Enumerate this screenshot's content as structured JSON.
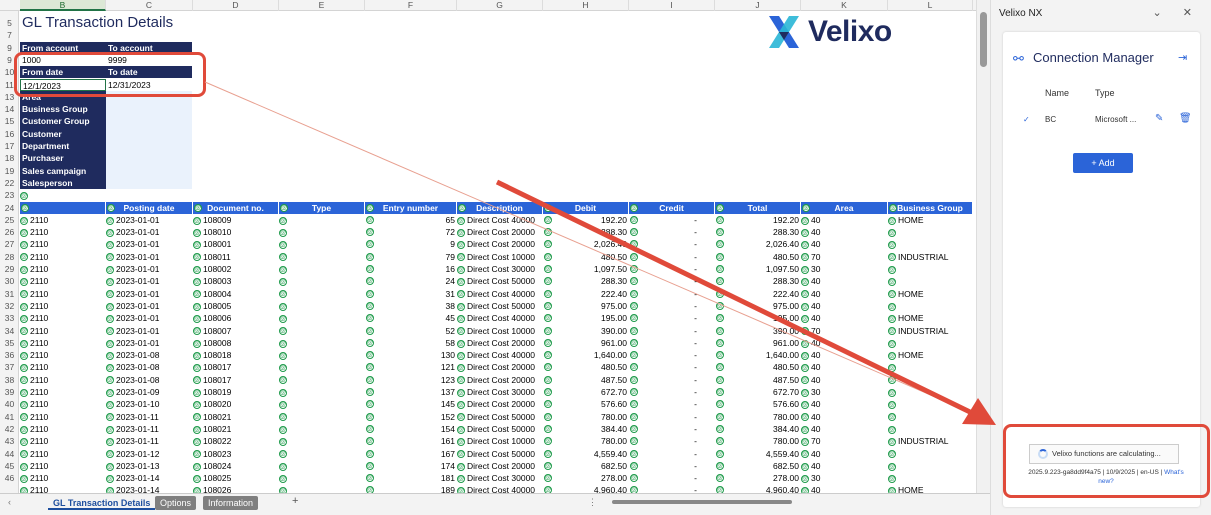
{
  "sheet": {
    "title": "GL Transaction Details",
    "logo_text": "Velixo",
    "column_letters": [
      "B",
      "C",
      "D",
      "E",
      "F",
      "G",
      "H",
      "I",
      "J",
      "K",
      "L"
    ],
    "row_numbers": [
      "5",
      "7",
      "9",
      "9",
      "10",
      "11",
      "13",
      "14",
      "15",
      "16",
      "17",
      "18",
      "19",
      "22",
      "23",
      "24",
      "25",
      "26",
      "27",
      "28",
      "29",
      "30",
      "31",
      "32",
      "33",
      "34",
      "35",
      "36",
      "37",
      "38",
      "39",
      "40",
      "41",
      "42",
      "43",
      "44",
      "45",
      "46"
    ],
    "params": {
      "from_account_label": "From account",
      "to_account_label": "To account",
      "from_account_value": "1000",
      "to_account_value": "9999",
      "from_date_label": "From date",
      "to_date_label": "To date",
      "from_date_value": "12/1/2023",
      "to_date_value": "12/31/2023",
      "area_label": "Area",
      "dims": [
        "Business Group",
        "Customer Group",
        "Customer",
        "Department",
        "Purchaser",
        "Sales campaign",
        "Salesperson"
      ]
    },
    "table_headers": [
      "",
      "Posting date",
      "Document no.",
      "Type",
      "Entry number",
      "Description",
      "Debit",
      "Credit",
      "Total",
      "Area",
      "Business Group"
    ],
    "rows": [
      [
        "2110",
        "2023-01-01",
        "108009",
        "",
        "65",
        "Direct Cost 40000",
        "192.20",
        "-",
        "192.20",
        "40",
        "HOME"
      ],
      [
        "2110",
        "2023-01-01",
        "108010",
        "",
        "72",
        "Direct Cost 20000",
        "288.30",
        "-",
        "288.30",
        "40",
        ""
      ],
      [
        "2110",
        "2023-01-01",
        "108001",
        "",
        "9",
        "Direct Cost 20000",
        "2,026.40",
        "-",
        "2,026.40",
        "40",
        ""
      ],
      [
        "2110",
        "2023-01-01",
        "108011",
        "",
        "79",
        "Direct Cost 10000",
        "480.50",
        "-",
        "480.50",
        "70",
        "INDUSTRIAL"
      ],
      [
        "2110",
        "2023-01-01",
        "108002",
        "",
        "16",
        "Direct Cost 30000",
        "1,097.50",
        "-",
        "1,097.50",
        "30",
        ""
      ],
      [
        "2110",
        "2023-01-01",
        "108003",
        "",
        "24",
        "Direct Cost 50000",
        "288.30",
        "-",
        "288.30",
        "40",
        ""
      ],
      [
        "2110",
        "2023-01-01",
        "108004",
        "",
        "31",
        "Direct Cost 40000",
        "222.40",
        "-",
        "222.40",
        "40",
        "HOME"
      ],
      [
        "2110",
        "2023-01-01",
        "108005",
        "",
        "38",
        "Direct Cost 50000",
        "975.00",
        "-",
        "975.00",
        "40",
        ""
      ],
      [
        "2110",
        "2023-01-01",
        "108006",
        "",
        "45",
        "Direct Cost 40000",
        "195.00",
        "-",
        "195.00",
        "40",
        "HOME"
      ],
      [
        "2110",
        "2023-01-01",
        "108007",
        "",
        "52",
        "Direct Cost 10000",
        "390.00",
        "-",
        "390.00",
        "70",
        "INDUSTRIAL"
      ],
      [
        "2110",
        "2023-01-01",
        "108008",
        "",
        "58",
        "Direct Cost 20000",
        "961.00",
        "-",
        "961.00",
        "40",
        ""
      ],
      [
        "2110",
        "2023-01-08",
        "108018",
        "",
        "130",
        "Direct Cost 40000",
        "1,640.00",
        "-",
        "1,640.00",
        "40",
        "HOME"
      ],
      [
        "2110",
        "2023-01-08",
        "108017",
        "",
        "121",
        "Direct Cost 20000",
        "480.50",
        "-",
        "480.50",
        "40",
        ""
      ],
      [
        "2110",
        "2023-01-08",
        "108017",
        "",
        "123",
        "Direct Cost 20000",
        "487.50",
        "-",
        "487.50",
        "40",
        ""
      ],
      [
        "2110",
        "2023-01-09",
        "108019",
        "",
        "137",
        "Direct Cost 30000",
        "672.70",
        "-",
        "672.70",
        "30",
        ""
      ],
      [
        "2110",
        "2023-01-10",
        "108020",
        "",
        "145",
        "Direct Cost 20000",
        "576.60",
        "-",
        "576.60",
        "40",
        ""
      ],
      [
        "2110",
        "2023-01-11",
        "108021",
        "",
        "152",
        "Direct Cost 50000",
        "780.00",
        "-",
        "780.00",
        "40",
        ""
      ],
      [
        "2110",
        "2023-01-11",
        "108021",
        "",
        "154",
        "Direct Cost 50000",
        "384.40",
        "-",
        "384.40",
        "40",
        ""
      ],
      [
        "2110",
        "2023-01-11",
        "108022",
        "",
        "161",
        "Direct Cost 10000",
        "780.00",
        "-",
        "780.00",
        "70",
        "INDUSTRIAL"
      ],
      [
        "2110",
        "2023-01-12",
        "108023",
        "",
        "167",
        "Direct Cost 50000",
        "4,559.40",
        "-",
        "4,559.40",
        "40",
        ""
      ],
      [
        "2110",
        "2023-01-13",
        "108024",
        "",
        "174",
        "Direct Cost 20000",
        "682.50",
        "-",
        "682.50",
        "40",
        ""
      ],
      [
        "2110",
        "2023-01-14",
        "108025",
        "",
        "181",
        "Direct Cost 30000",
        "278.00",
        "-",
        "278.00",
        "30",
        ""
      ],
      [
        "2110",
        "2023-01-14",
        "108026",
        "",
        "189",
        "Direct Cost 40000",
        "4,960.40",
        "-",
        "4,960.40",
        "40",
        "HOME"
      ]
    ],
    "tabs": [
      "GL Transaction Details",
      "Options",
      "Information"
    ],
    "add_sheet": "+"
  },
  "pane": {
    "header": "Velixo NX",
    "controls": "⌄ ✕",
    "title": "Connection Manager",
    "col_name": "Name",
    "col_type": "Type",
    "conn_name": "BC",
    "conn_type": "Microsoft ...",
    "add_label": "Add",
    "status": "Velixo functions are calculating...",
    "version": "2025.9.223-ga8dd9f4a75 | 10/9/2025 | en-US | ",
    "whats_new": "What's new?"
  },
  "colors": {
    "navy": "#1f2b5e",
    "blue": "#2b64d8",
    "red": "#e04a3a",
    "green": "#1e9a4a"
  }
}
